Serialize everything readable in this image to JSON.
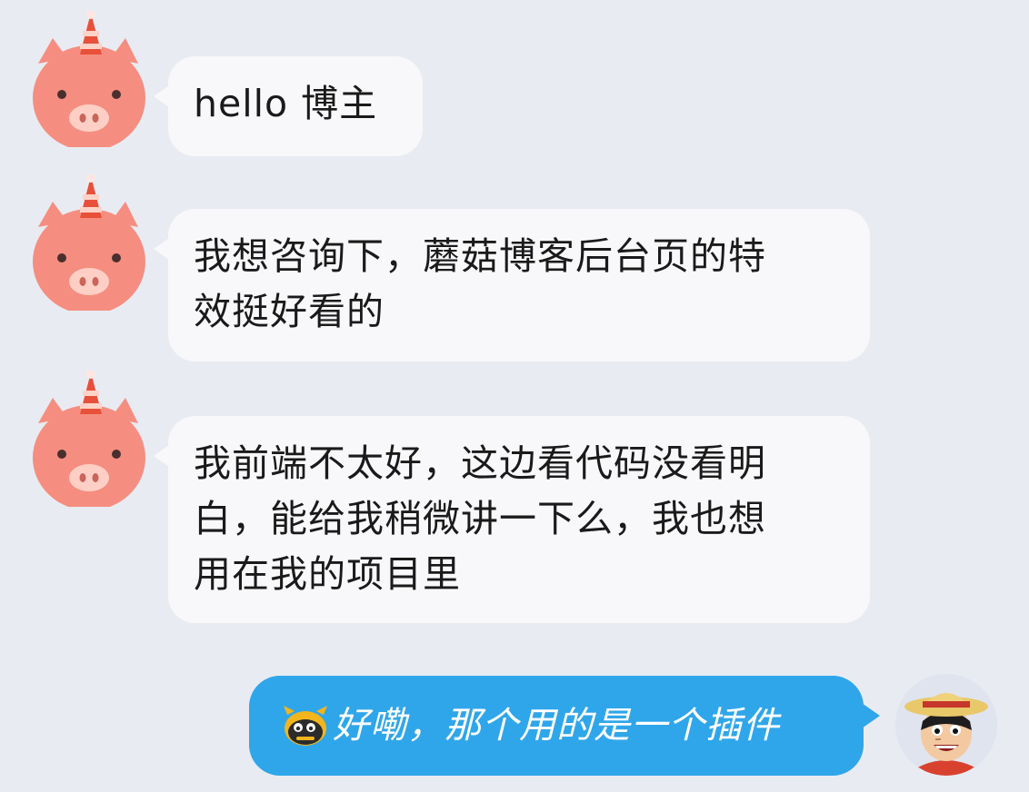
{
  "messages": [
    {
      "side": "left",
      "sender_avatar": "pig-unicorn-avatar",
      "text": "hello 博主"
    },
    {
      "side": "left",
      "sender_avatar": "pig-unicorn-avatar",
      "lines": [
        "我想咨询下，蘑菇博客后台页的特",
        "效挺好看的"
      ]
    },
    {
      "side": "left",
      "sender_avatar": "pig-unicorn-avatar",
      "lines": [
        "我前端不太好，这边看代码没看明",
        "白，能给我稍微讲一下么，我也想",
        "用在我的项目里"
      ]
    },
    {
      "side": "right",
      "sender_avatar": "straw-hat-boy-avatar",
      "emoji": "cow-emoji",
      "text": "好嘞，那个用的是一个插件"
    }
  ],
  "colors": {
    "background": "#e9ebf2",
    "received_bubble": "#f8f8fa",
    "sent_bubble": "#2fa6ea",
    "sent_text": "#ffffff"
  }
}
